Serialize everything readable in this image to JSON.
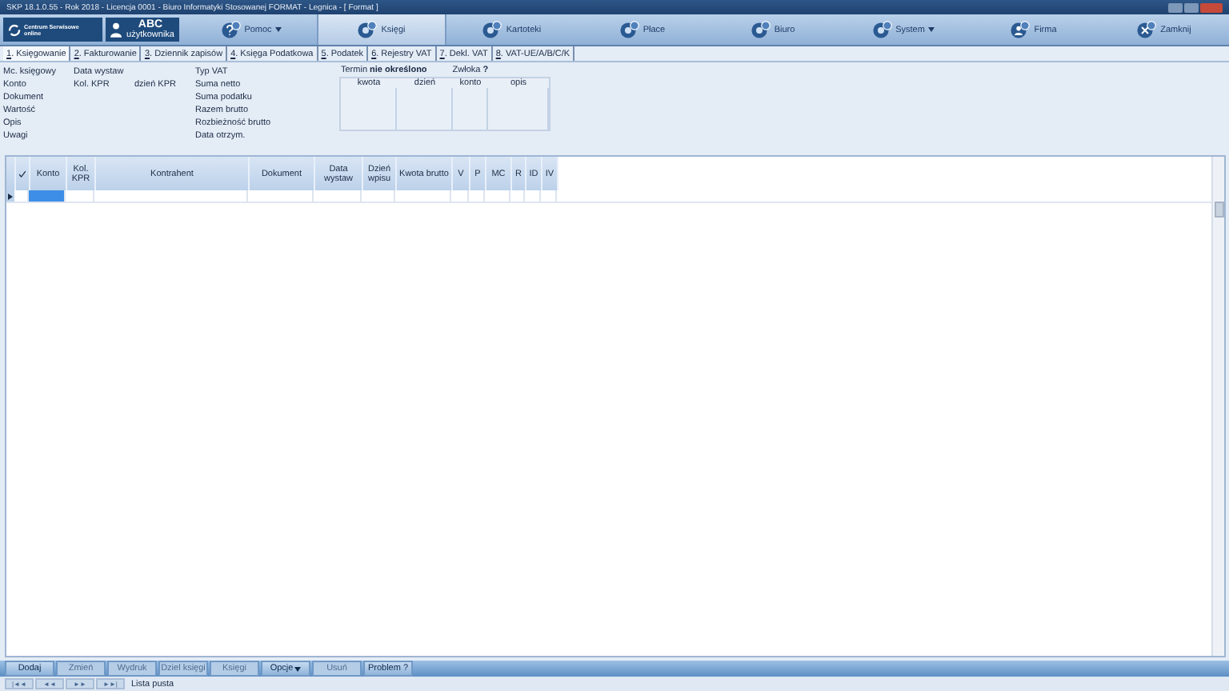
{
  "window": {
    "title": "SKP 18.1.0.55 - Rok 2018 - Licencja 0001 - Biuro Informatyki Stosowanej FORMAT - Legnica - [ Format ]"
  },
  "toolbar": {
    "logo": {
      "line1": "Centrum Serwisowe",
      "line2": "online"
    },
    "user": {
      "line1": "ABC",
      "line2": "użytkownika"
    },
    "buttons": [
      {
        "label": "Pomoc",
        "dropdown": true,
        "selected": false,
        "kind": "help"
      },
      {
        "label": "Księgi",
        "dropdown": false,
        "selected": true,
        "kind": "app"
      },
      {
        "label": "Kartoteki",
        "dropdown": false,
        "selected": false,
        "kind": "app"
      },
      {
        "label": "Płace",
        "dropdown": false,
        "selected": false,
        "kind": "app"
      },
      {
        "label": "Biuro",
        "dropdown": false,
        "selected": false,
        "kind": "app"
      },
      {
        "label": "System",
        "dropdown": true,
        "selected": false,
        "kind": "app"
      },
      {
        "label": "Firma",
        "dropdown": false,
        "selected": false,
        "kind": "person"
      },
      {
        "label": "Zamknij",
        "dropdown": false,
        "selected": false,
        "kind": "close"
      }
    ]
  },
  "tabs": [
    {
      "key": "1",
      "label": ". Księgowanie",
      "selected": true
    },
    {
      "key": "2",
      "label": ". Fakturowanie",
      "selected": false
    },
    {
      "key": "3",
      "label": ". Dziennik zapisów",
      "selected": false
    },
    {
      "key": "4",
      "label": ". Księga Podatkowa",
      "selected": false
    },
    {
      "key": "5",
      "label": ". Podatek",
      "selected": false
    },
    {
      "key": "6",
      "label": ". Rejestry VAT",
      "selected": false
    },
    {
      "key": "7",
      "label": ". Dekl. VAT",
      "selected": false
    },
    {
      "key": "8",
      "label": ". VAT-UE/A/B/C/K",
      "selected": false
    }
  ],
  "form": {
    "column_1": [
      "Mc. księgowy",
      "Konto",
      "Dokument",
      "Wartość",
      "Opis",
      "Uwagi"
    ],
    "column_2": [
      "Data wystaw",
      "Kol. KPR"
    ],
    "column_3": [
      "dzień KPR"
    ],
    "column_4": [
      "Typ VAT",
      "Suma netto",
      "Suma podatku",
      "Razem brutto",
      "Rozbieżność brutto",
      "Data otrzym."
    ],
    "deadline": {
      "termin": "Termin **nie określono**",
      "zwloka": "Zwłoka **?**",
      "columns": [
        "kwota",
        "dzień",
        "konto",
        "opis"
      ]
    }
  },
  "grid": {
    "columns": [
      "Konto",
      "Kol. KPR",
      "Kontrahent",
      "Dokument",
      "Data wystaw",
      "Dzień wpisu",
      "Kwota brutto",
      "V",
      "P",
      "MC",
      "R",
      "ID",
      "IV"
    ],
    "rows": [
      {
        "selected": true
      }
    ]
  },
  "bottom_buttons": [
    {
      "label": "Dodaj",
      "disabled": false,
      "dropdown": false
    },
    {
      "label": "Zmień",
      "disabled": true,
      "dropdown": false
    },
    {
      "label": "Wydruk",
      "disabled": true,
      "dropdown": false
    },
    {
      "label": "Dziel księgi",
      "disabled": true,
      "dropdown": false
    },
    {
      "label": "Księgi",
      "disabled": true,
      "dropdown": false
    },
    {
      "label": "Opcje",
      "disabled": false,
      "dropdown": true
    },
    {
      "label": "Usuń",
      "disabled": true,
      "dropdown": false
    },
    {
      "label": "Problem ?",
      "disabled": false,
      "dropdown": false
    }
  ],
  "navigation": [
    "|◄◄",
    "◄◄",
    "►►",
    "►►|"
  ],
  "status": "Lista pusta"
}
